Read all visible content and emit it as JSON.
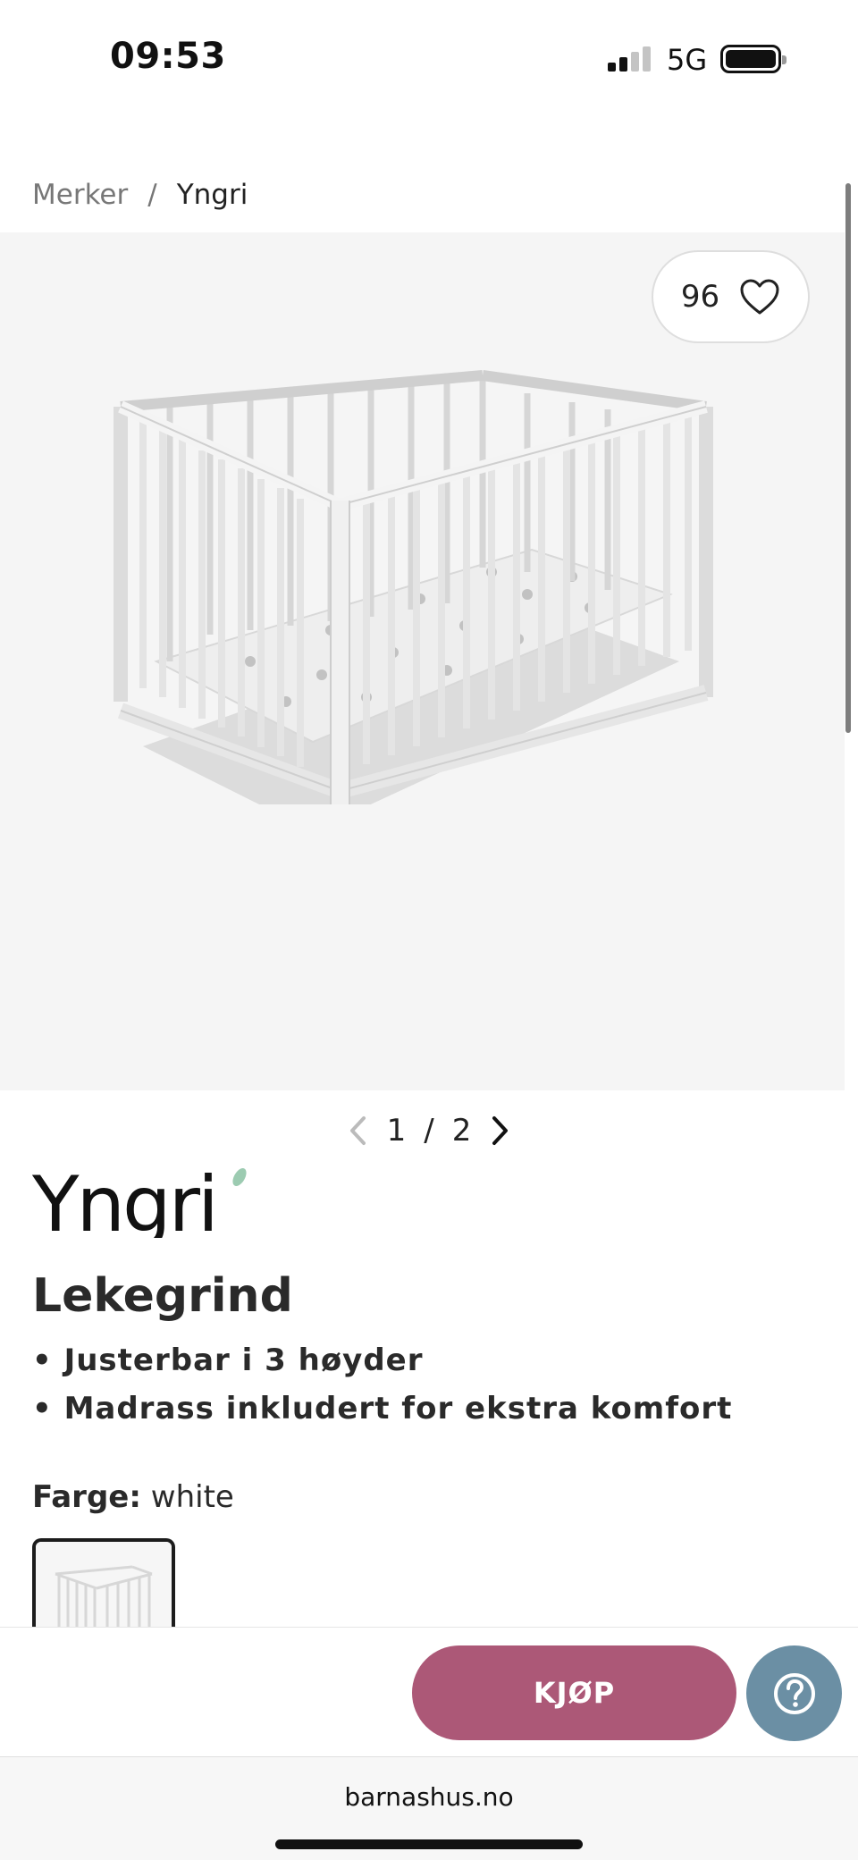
{
  "status_bar": {
    "time": "09:53",
    "network": "5G"
  },
  "breadcrumb": {
    "items": [
      "Merker",
      "Yngri"
    ],
    "separator": "/"
  },
  "gallery": {
    "favorites_count": "96",
    "current": "1",
    "total": "2",
    "separator": "/"
  },
  "product": {
    "brand": "Yngri",
    "name": "Lekegrind",
    "features": [
      "• Justerbar i 3 høyder",
      "• Madrass inkludert for ekstra komfort"
    ],
    "color_label": "Farge:",
    "color_value": "white"
  },
  "actions": {
    "buy_label": "KJØP"
  },
  "browser": {
    "url": "barnashus.no"
  },
  "colors": {
    "buy": "#ac5877",
    "help": "#6b8fa4",
    "gallery_bg": "#f5f5f5"
  },
  "icons": [
    "heart-icon",
    "chevron-left-icon",
    "chevron-right-icon",
    "help-icon"
  ]
}
